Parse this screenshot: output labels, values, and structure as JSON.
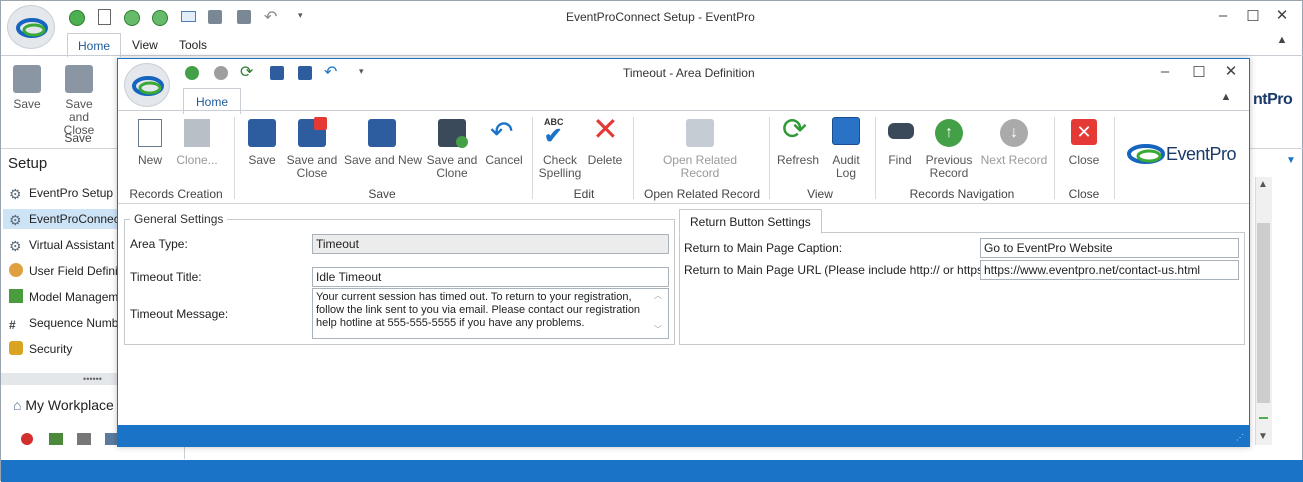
{
  "outer": {
    "title": "EventProConnect Setup - EventPro",
    "tabs": [
      "Home",
      "View",
      "Tools"
    ],
    "ribbon": {
      "save": "Save",
      "save_close": "Save and Close",
      "group_save": "Save"
    },
    "nav_title": "Setup",
    "nav_items": [
      "EventPro Setup",
      "EventProConnect",
      "Virtual Assistant Se",
      "User Field Definitio",
      "Model Managemen",
      "Sequence Number",
      "Security"
    ],
    "workplace": "My Workplace",
    "logo_text": "ntPro"
  },
  "dialog": {
    "title": "Timeout - Area Definition",
    "tab": "Home",
    "buttons": {
      "new": "New",
      "clone": "Clone...",
      "save": "Save",
      "save_close": "Save and Close",
      "save_new": "Save and New",
      "save_clone": "Save and Clone",
      "cancel": "Cancel",
      "check": "Check Spelling",
      "delete": "Delete",
      "open_related": "Open Related Record",
      "refresh": "Refresh",
      "audit": "Audit Log",
      "find": "Find",
      "prev": "Previous Record",
      "next": "Next Record",
      "close": "Close"
    },
    "groups": {
      "records_creation": "Records Creation",
      "save": "Save",
      "edit": "Edit",
      "open_related": "Open Related Record",
      "view": "View",
      "nav": "Records Navigation",
      "close": "Close"
    },
    "logo": "EventPro",
    "general": {
      "title": "General Settings",
      "area_type_label": "Area Type:",
      "area_type": "Timeout",
      "timeout_title_label": "Timeout Title:",
      "timeout_title": "Idle Timeout",
      "timeout_message_label": "Timeout Message:",
      "timeout_message": "Your current session has timed out. To return to your registration, follow the link sent to you via email. Please contact our registration help hotline at 555-555-5555 if you have any problems."
    },
    "return": {
      "tab": "Return Button Settings",
      "caption_label": "Return to Main Page Caption:",
      "caption": "Go to EventPro Website",
      "url_label": "Return to Main Page URL (Please include http:// or https://):",
      "url": "https://www.eventpro.net/contact-us.html"
    }
  },
  "colors": {
    "accent": "#0f6cbd",
    "status_bar": "#1a73c7"
  }
}
